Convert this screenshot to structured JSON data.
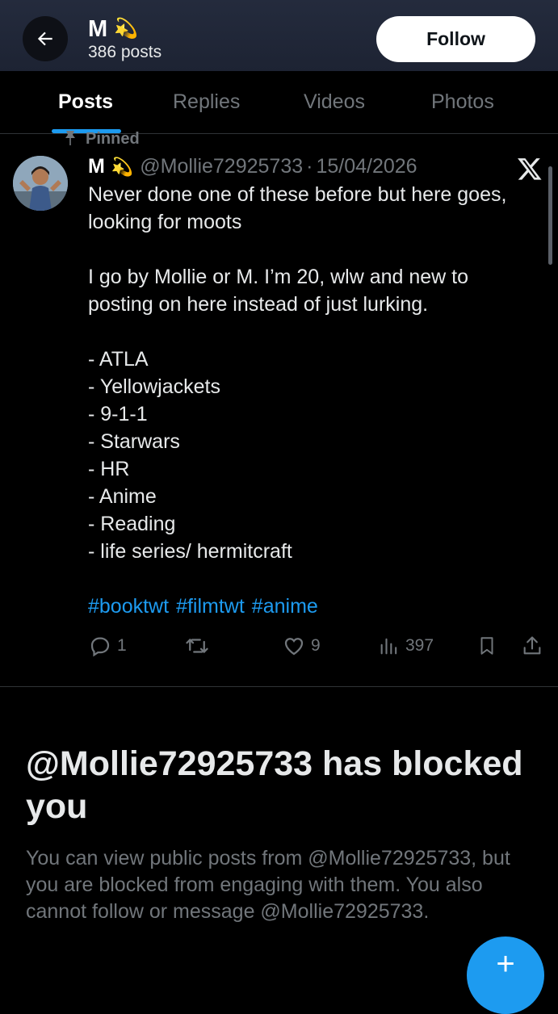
{
  "header": {
    "name": "M",
    "name_emoji": "💫",
    "post_count": "386 posts",
    "follow_label": "Follow"
  },
  "tabs": [
    {
      "label": "Posts",
      "active": true
    },
    {
      "label": "Replies",
      "active": false
    },
    {
      "label": "Videos",
      "active": false
    },
    {
      "label": "Photos",
      "active": false
    }
  ],
  "post": {
    "pinned_label": "Pinned",
    "author_name": "M",
    "author_emoji": "💫",
    "handle": "@Mollie72925733",
    "separator": "·",
    "date": "15/04/2026",
    "lines": [
      "Never done one of these before but here goes,",
      "looking for moots",
      "",
      "I go by Mollie or M. I’m 20, wlw and new to",
      "posting on here instead of just lurking.",
      "",
      "- ATLA",
      "- Yellowjackets",
      "- 9-1-1",
      "- Starwars",
      "- HR",
      "- Anime",
      "- Reading",
      "- life series/ hermitcraft",
      ""
    ],
    "hashtags": [
      "#booktwt",
      "#filmtwt",
      "#anime"
    ],
    "stats": {
      "replies": "1",
      "likes": "9",
      "views": "397"
    }
  },
  "blocked": {
    "title": "@Mollie72925733 has blocked you",
    "description": "You can view public posts from @Mollie72925733, but you are blocked from engaging with them. You also cannot follow or message @Mollie72925733."
  },
  "icons": {
    "back": "back-arrow-icon",
    "x_logo": "x-logo-icon",
    "reply": "reply-icon",
    "repost": "repost-icon",
    "like": "like-icon",
    "views": "views-icon",
    "bookmark": "bookmark-icon",
    "share": "share-icon",
    "compose": "compose-icon"
  },
  "colors": {
    "accent": "#1d9bf0",
    "muted": "#71767b",
    "header_bg": "#242b3d"
  }
}
